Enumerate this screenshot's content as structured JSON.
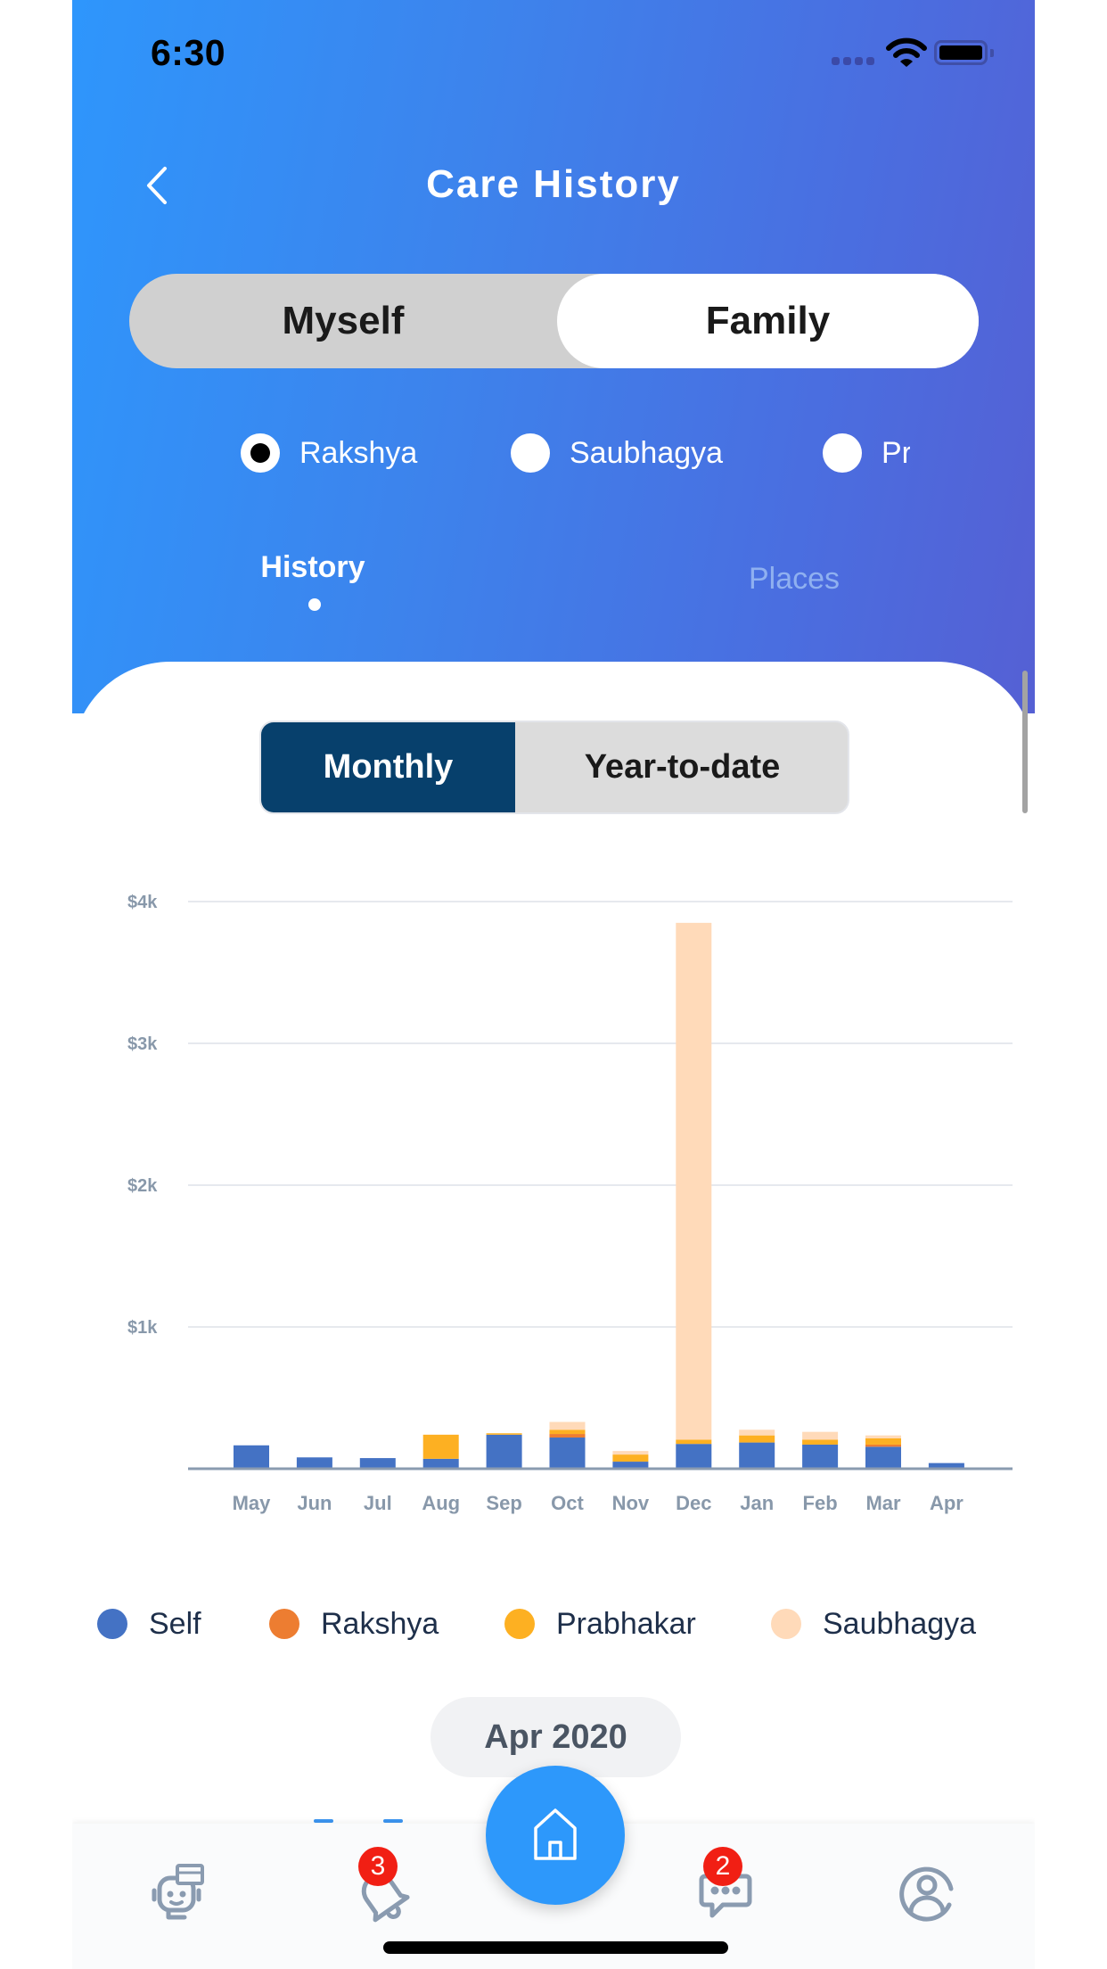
{
  "status_bar": {
    "time": "6:30"
  },
  "header": {
    "title": "Care History",
    "back_icon": "chevron-left-icon"
  },
  "segment": {
    "options": [
      {
        "label": "Myself",
        "selected": false
      },
      {
        "label": "Family",
        "selected": true
      }
    ]
  },
  "members": [
    {
      "label": "Rakshya",
      "checked": true
    },
    {
      "label": "Saubhagya",
      "checked": false
    },
    {
      "label": "Prabhakar",
      "checked": false
    }
  ],
  "tabs": [
    {
      "label": "History",
      "active": true
    },
    {
      "label": "Places",
      "active": false
    }
  ],
  "period_toggle": {
    "options": [
      {
        "label": "Monthly",
        "selected": true
      },
      {
        "label": "Year-to-date",
        "selected": false
      }
    ]
  },
  "chart_data": {
    "type": "bar",
    "stacked": true,
    "title": "",
    "xlabel": "",
    "ylabel": "",
    "ylim": [
      0,
      4000
    ],
    "yticks": [
      1000,
      2000,
      3000,
      4000
    ],
    "ytick_labels": [
      "$1k",
      "$2k",
      "$3k",
      "$4k"
    ],
    "grid": true,
    "legend_position": "bottom",
    "categories": [
      "May",
      "Jun",
      "Jul",
      "Aug",
      "Sep",
      "Oct",
      "Nov",
      "Dec",
      "Jan",
      "Feb",
      "Mar",
      "Apr"
    ],
    "series": [
      {
        "name": "Self",
        "color": "#4472c4",
        "values": [
          165,
          80,
          75,
          70,
          240,
          220,
          50,
          175,
          185,
          170,
          155,
          40
        ]
      },
      {
        "name": "Rakshya",
        "color": "#ed7d31",
        "values": [
          0,
          0,
          0,
          0,
          0,
          25,
          0,
          0,
          0,
          0,
          15,
          0
        ]
      },
      {
        "name": "Prabhakar",
        "color": "#fdb022",
        "values": [
          0,
          0,
          0,
          170,
          10,
          30,
          50,
          30,
          50,
          35,
          45,
          0
        ]
      },
      {
        "name": "Saubhagya",
        "color": "#ffdab9",
        "values": [
          0,
          0,
          0,
          0,
          0,
          55,
          25,
          3645,
          40,
          55,
          20,
          0
        ]
      }
    ]
  },
  "selected_period": "Apr 2020",
  "tabbar": {
    "items": [
      {
        "name": "assistant",
        "icon": "chatbot-icon",
        "badge": null
      },
      {
        "name": "notifications",
        "icon": "bell-icon",
        "badge": "3"
      },
      {
        "name": "home",
        "icon": "home-icon",
        "badge": null
      },
      {
        "name": "messages",
        "icon": "chat-bubble-icon",
        "badge": "2"
      },
      {
        "name": "profile",
        "icon": "profile-icon",
        "badge": null
      }
    ]
  },
  "colors": {
    "accent": "#2d98fb",
    "header_gradient_start": "#2e96fc",
    "header_gradient_end": "#5560d4",
    "toggle_active": "#07406c",
    "badge": "#f11f14",
    "icon_gray": "#8a9bb0"
  }
}
